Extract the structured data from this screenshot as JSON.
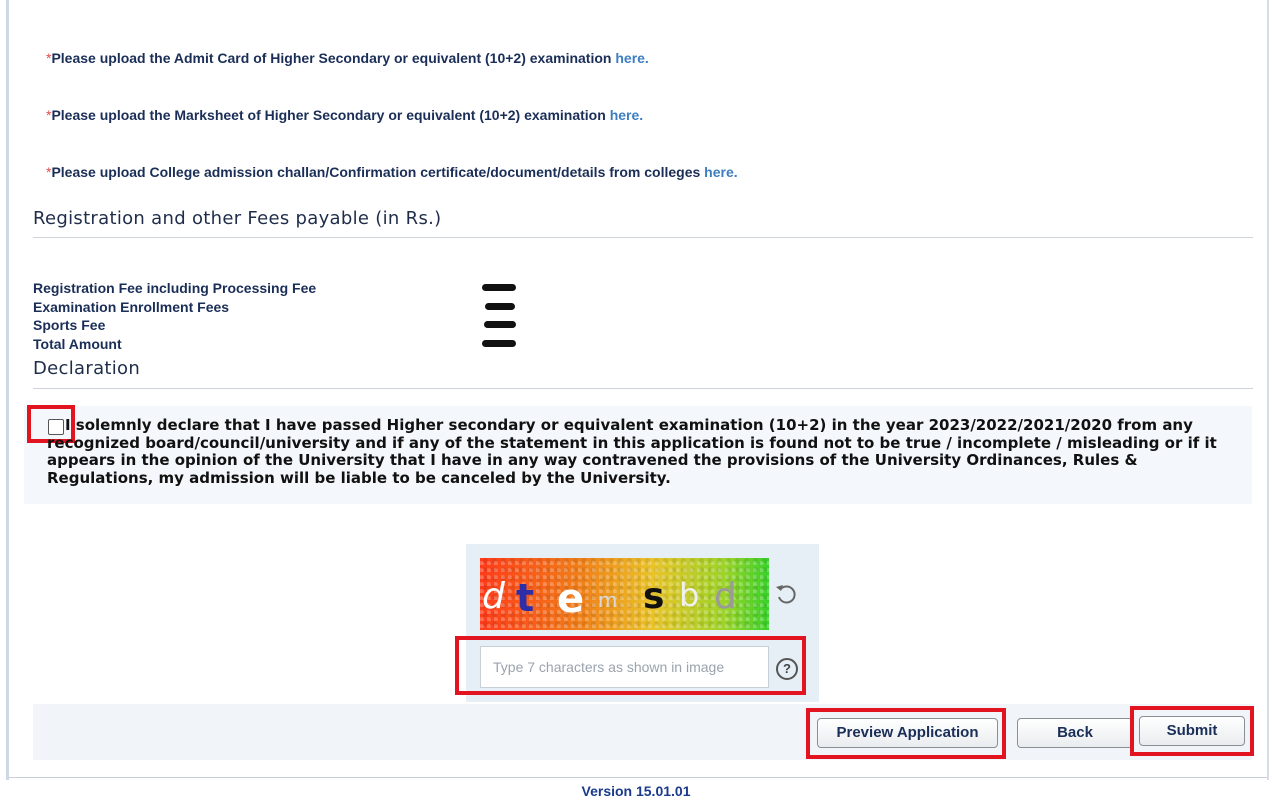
{
  "uploads": [
    {
      "text": "Please upload the Admit Card of Higher Secondary or equivalent (10+2) examination",
      "link": "here."
    },
    {
      "text": "Please upload the Marksheet of Higher Secondary or equivalent (10+2) examination",
      "link": "here."
    },
    {
      "text": "Please upload College admission challan/Confirmation certificate/document/details from colleges",
      "link": "here."
    }
  ],
  "required_marker": "*",
  "fees": {
    "title": "Registration and other Fees payable (in Rs.)",
    "rows": [
      {
        "label": "Registration Fee including Processing Fee"
      },
      {
        "label": "Examination Enrollment Fees"
      },
      {
        "label": "Sports Fee"
      },
      {
        "label": "Total Amount"
      }
    ]
  },
  "declaration": {
    "title": "Declaration",
    "text": "I solemnly declare that I have passed Higher secondary or equivalent examination (10+2) in the year 2023/2022/2021/2020 from any recognized board/council/university and if any of the statement in this application is found not to be true / incomplete / misleading or if it appears in the opinion of the University that I have in any way contravened the provisions of the University Ordinances, Rules & Regulations, my admission will be liable to be canceled by the University.",
    "checked": false
  },
  "captcha": {
    "characters": [
      "d",
      "t",
      "e",
      "m",
      "s",
      "b",
      "d"
    ],
    "char_colors": [
      "#ffffff",
      "#2e2ea8",
      "#ffffff",
      "#d8d8d8",
      "#111111",
      "#f0f0f0",
      "#9a9a9a"
    ],
    "placeholder": "Type 7 characters as shown in image",
    "refresh_icon": "refresh-icon",
    "help_glyph": "?"
  },
  "buttons": {
    "preview": "Preview Application",
    "back": "Back",
    "submit": "Submit"
  },
  "version": "Version 15.01.01",
  "colors": {
    "highlight": "#e1141f",
    "link": "#3d7ec1",
    "required": "#e34b4b"
  }
}
